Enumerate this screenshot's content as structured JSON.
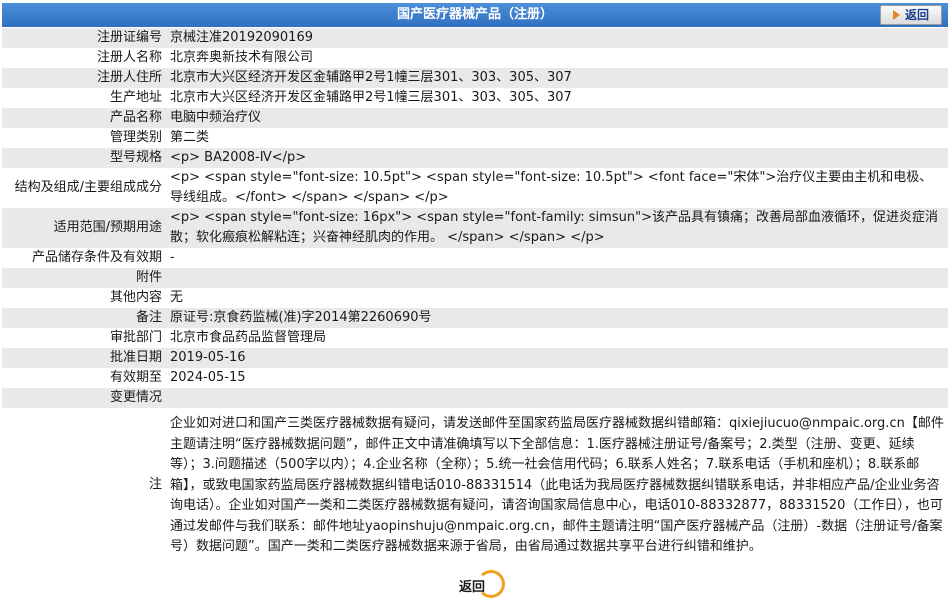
{
  "header": {
    "title": "国产医疗器械产品（注册）",
    "back_label": "返回"
  },
  "rows": [
    {
      "label": "注册证编号",
      "value": "京械注准20192090169"
    },
    {
      "label": "注册人名称",
      "value": "北京奔奥新技术有限公司"
    },
    {
      "label": "注册人住所",
      "value": "北京市大兴区经济开发区金辅路甲2号1幢三层301、303、305、307"
    },
    {
      "label": "生产地址",
      "value": "北京市大兴区经济开发区金辅路甲2号1幢三层301、303、305、307"
    },
    {
      "label": "产品名称",
      "value": "电脑中频治疗仪"
    },
    {
      "label": "管理类别",
      "value": "第二类"
    },
    {
      "label": "型号规格",
      "value": "<p> BA2008-Ⅳ</p>"
    },
    {
      "label": "结构及组成/主要组成成分",
      "value": "<p> <span style=\"font-size: 10.5pt\"> <span style=\"font-size: 10.5pt\"> <font face=\"宋体\">治疗仪主要由主机和电极、导线组成。</font> </span> </span> </p>"
    },
    {
      "label": "适用范围/预期用途",
      "value": "<p> <span style=\"font-size: 16px\"> <span style=\"font-family: simsun\">该产品具有镇痛；改善局部血液循环，促进炎症消散；软化瘢痕松解粘连；兴奋神经肌肉的作用。 </span> </span> </p>"
    },
    {
      "label": "产品储存条件及有效期",
      "value": "-"
    },
    {
      "label": "附件",
      "value": ""
    },
    {
      "label": "其他内容",
      "value": "无"
    },
    {
      "label": "备注",
      "value": "原证号:京食药监械(准)字2014第2260690号"
    },
    {
      "label": "审批部门",
      "value": "北京市食品药品监督管理局"
    },
    {
      "label": "批准日期",
      "value": "2019-05-16"
    },
    {
      "label": "有效期至",
      "value": "2024-05-15"
    },
    {
      "label": "变更情况",
      "value": ""
    }
  ],
  "note": {
    "label": "注",
    "text": "企业如对进口和国产三类医疗器械数据有疑问，请发送邮件至国家药监局医疗器械数据纠错邮箱：qixiejiucuo@nmpaic.org.cn【邮件主题请注明“医疗器械数据问题”，邮件正文中请准确填写以下全部信息：1.医疗器械注册证号/备案号；2.类型（注册、变更、延续等）；3.问题描述（500字以内）；4.企业名称（全称）；5.统一社会信用代码；6.联系人姓名；7.联系电话（手机和座机）；8.联系邮箱】，或致电国家药监局医疗器械数据纠错电话010-88331514（此电话为我局医疗器械数据纠错联系电话，并非相应产品/企业业务咨询电话）。企业如对国产一类和二类医疗器械数据有疑问，请咨询国家局信息中心，电话010-88332877，88331520（工作日），也可通过发邮件与我们联系：邮件地址yaopinshuju@nmpaic.org.cn，邮件主题请注明“国产医疗器械产品（注册）-数据（注册证号/备案号）数据问题”。国产一类和二类医疗器械数据来源于省局，由省局通过数据共享平台进行纠错和维护。"
  },
  "footer": {
    "back_label": "返回"
  },
  "colors": {
    "header_bg": "#3a7bd0",
    "row_gray": "#e9e9e9",
    "row_white": "#ffffff",
    "accent_orange": "#f0a020"
  }
}
